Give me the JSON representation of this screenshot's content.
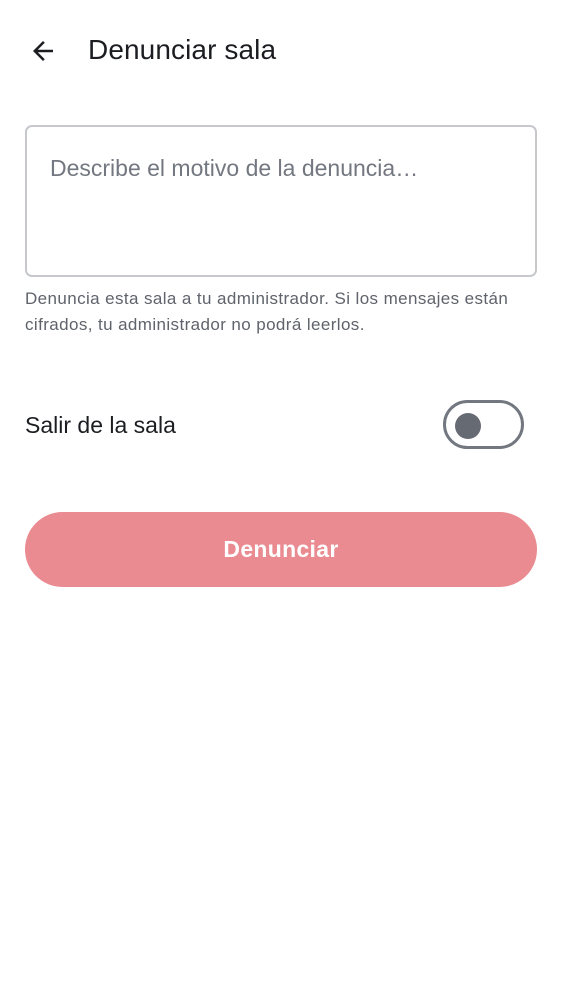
{
  "header": {
    "title": "Denunciar sala",
    "back_icon": "arrow-back-icon"
  },
  "reason": {
    "placeholder": "Describe el motivo de la denuncia…",
    "value": ""
  },
  "helper_text": "Denuncia esta sala a tu administrador. Si los mensajes están cifrados, tu administrador no podrá leerlos.",
  "leave_room": {
    "label": "Salir de la sala",
    "enabled": false
  },
  "submit": {
    "label": "Denunciar",
    "enabled": false
  },
  "colors": {
    "accent_disabled": "#e98b91",
    "text_primary": "#1b1d21",
    "text_secondary": "#5f636b",
    "outline": "#c6c8cc"
  }
}
